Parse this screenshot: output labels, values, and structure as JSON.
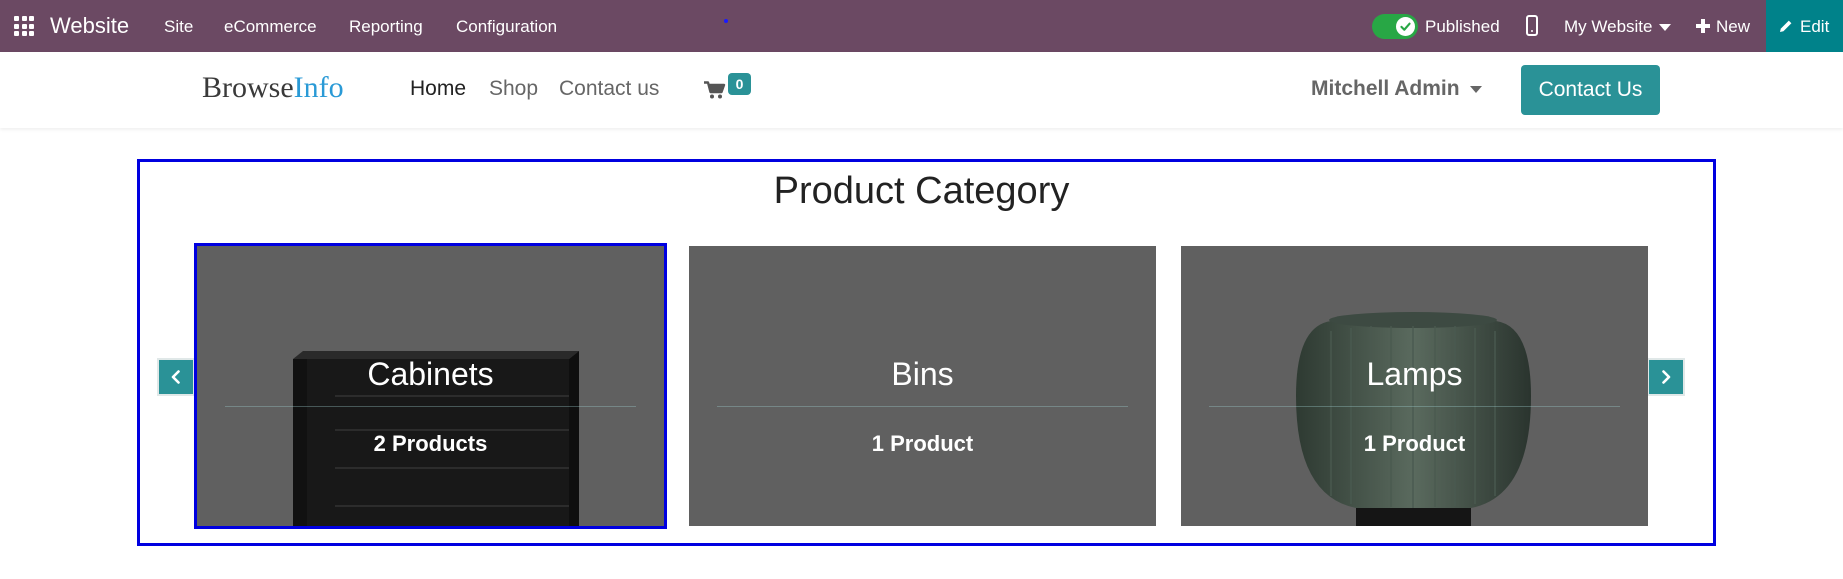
{
  "adminbar": {
    "app_title": "Website",
    "menu": [
      "Site",
      "eCommerce",
      "Reporting",
      "Configuration"
    ],
    "published_label": "Published",
    "published": true,
    "website_selector": "My Website",
    "new_label": "New",
    "edit_label": "Edit"
  },
  "header": {
    "logo_part1": "Browse",
    "logo_part2": "Info",
    "nav": [
      "Home",
      "Shop",
      "Contact us"
    ],
    "active_nav": "Home",
    "cart_count": "0",
    "user_name": "Mitchell Admin",
    "contact_button": "Contact Us"
  },
  "section": {
    "title": "Product Category",
    "categories": [
      {
        "name": "Cabinets",
        "count": "2 Products",
        "image_icon": "cabinet-image"
      },
      {
        "name": "Bins",
        "count": "1 Product",
        "image_icon": ""
      },
      {
        "name": "Lamps",
        "count": "1 Product",
        "image_icon": "lamp-image"
      }
    ]
  },
  "colors": {
    "adminbar_bg": "#6b4963",
    "edit_bg": "#00828a",
    "accent": "#2a9297",
    "selection_outline": "#0000e0",
    "card_overlay": "#606060"
  }
}
